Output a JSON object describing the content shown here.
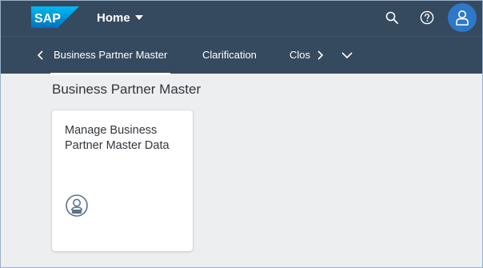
{
  "shell": {
    "logo_text": "SAP",
    "home_label": "Home",
    "icons": [
      "search-icon",
      "help-icon",
      "user-icon"
    ]
  },
  "tabs": [
    {
      "label": "Business Partner Master",
      "active": true
    },
    {
      "label": "Clarification",
      "active": false
    },
    {
      "label": "Clos",
      "active": false
    }
  ],
  "section": {
    "title": "Business Partner Master"
  },
  "tile": {
    "title": "Manage Business Partner Master Data",
    "icon": "person-badge-icon"
  },
  "colors": {
    "shell_bg": "#354a5f",
    "content_bg": "#eceef0",
    "avatar_bg": "#2d78c8",
    "icon_color": "#5b738b",
    "text": "#32363a"
  }
}
